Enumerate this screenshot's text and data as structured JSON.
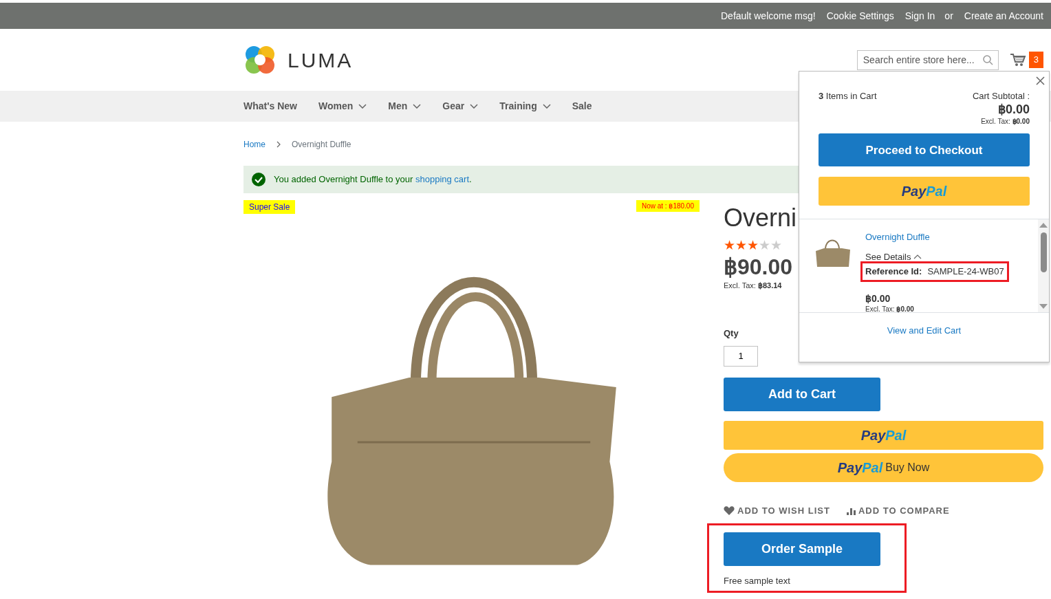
{
  "top_links": [
    {
      "text": "Default welcome msg!",
      "kind": "text"
    },
    {
      "text": "Cookie Settings",
      "kind": "link"
    },
    {
      "text": "Sign In",
      "kind": "link"
    },
    {
      "text": "or",
      "kind": "text"
    },
    {
      "text": "Create an Account",
      "kind": "link"
    }
  ],
  "logo": {
    "text": "LUMA"
  },
  "search": {
    "placeholder": "Search entire store here..."
  },
  "cart": {
    "count": "3"
  },
  "nav": [
    {
      "label": "What's New",
      "has_submenu": false
    },
    {
      "label": "Women",
      "has_submenu": true
    },
    {
      "label": "Men",
      "has_submenu": true
    },
    {
      "label": "Gear",
      "has_submenu": true
    },
    {
      "label": "Training",
      "has_submenu": true
    },
    {
      "label": "Sale",
      "has_submenu": false
    }
  ],
  "breadcrumbs": [
    {
      "label": "Home",
      "current": false
    },
    {
      "label": "Overnight Duffle",
      "current": true
    }
  ],
  "message": {
    "text": "You added Overnight Duffle to your",
    "link": "shopping cart",
    "end": "."
  },
  "badges": {
    "left": "Super Sale",
    "right": "Now at : ฿180.00"
  },
  "product": {
    "title": "Overni",
    "stars": 3,
    "price": "฿90.00",
    "excl_tax_label": "Excl. Tax:",
    "excl_tax": "฿83.14",
    "qty_label": "Qty",
    "qty": "1",
    "add_to_cart": "Add to Cart",
    "paypal_logo": [
      "Pay",
      "Pal"
    ],
    "buy_now_logo": [
      "Pay",
      "Pal"
    ],
    "buy_now": "Buy Now",
    "wish_list": "ADD TO WISH LIST",
    "compare": "ADD TO COMPARE",
    "order_sample": "Order Sample",
    "sample_text": "Free sample text",
    "sample_highlighted": true
  },
  "minicart": {
    "count": "3",
    "count_label": "Items in Cart",
    "subtotal_label": "Cart Subtotal :",
    "subtotal": "฿0.00",
    "excl_tax_label": "Excl. Tax:",
    "excl_tax": "฿0.00",
    "checkout": "Proceed to Checkout",
    "paypal_logo": [
      "Pay",
      "Pal"
    ],
    "item": {
      "name": "Overnight Duffle",
      "see_details": "See Details",
      "details_expanded": true,
      "ref_label": "Reference Id:",
      "ref_value": "SAMPLE-24-WB07",
      "ref_highlighted": true,
      "price": "฿0.00",
      "excl_tax_label": "Excl. Tax:",
      "excl_tax": "฿0.00"
    },
    "view_edit": "View and Edit Cart"
  }
}
